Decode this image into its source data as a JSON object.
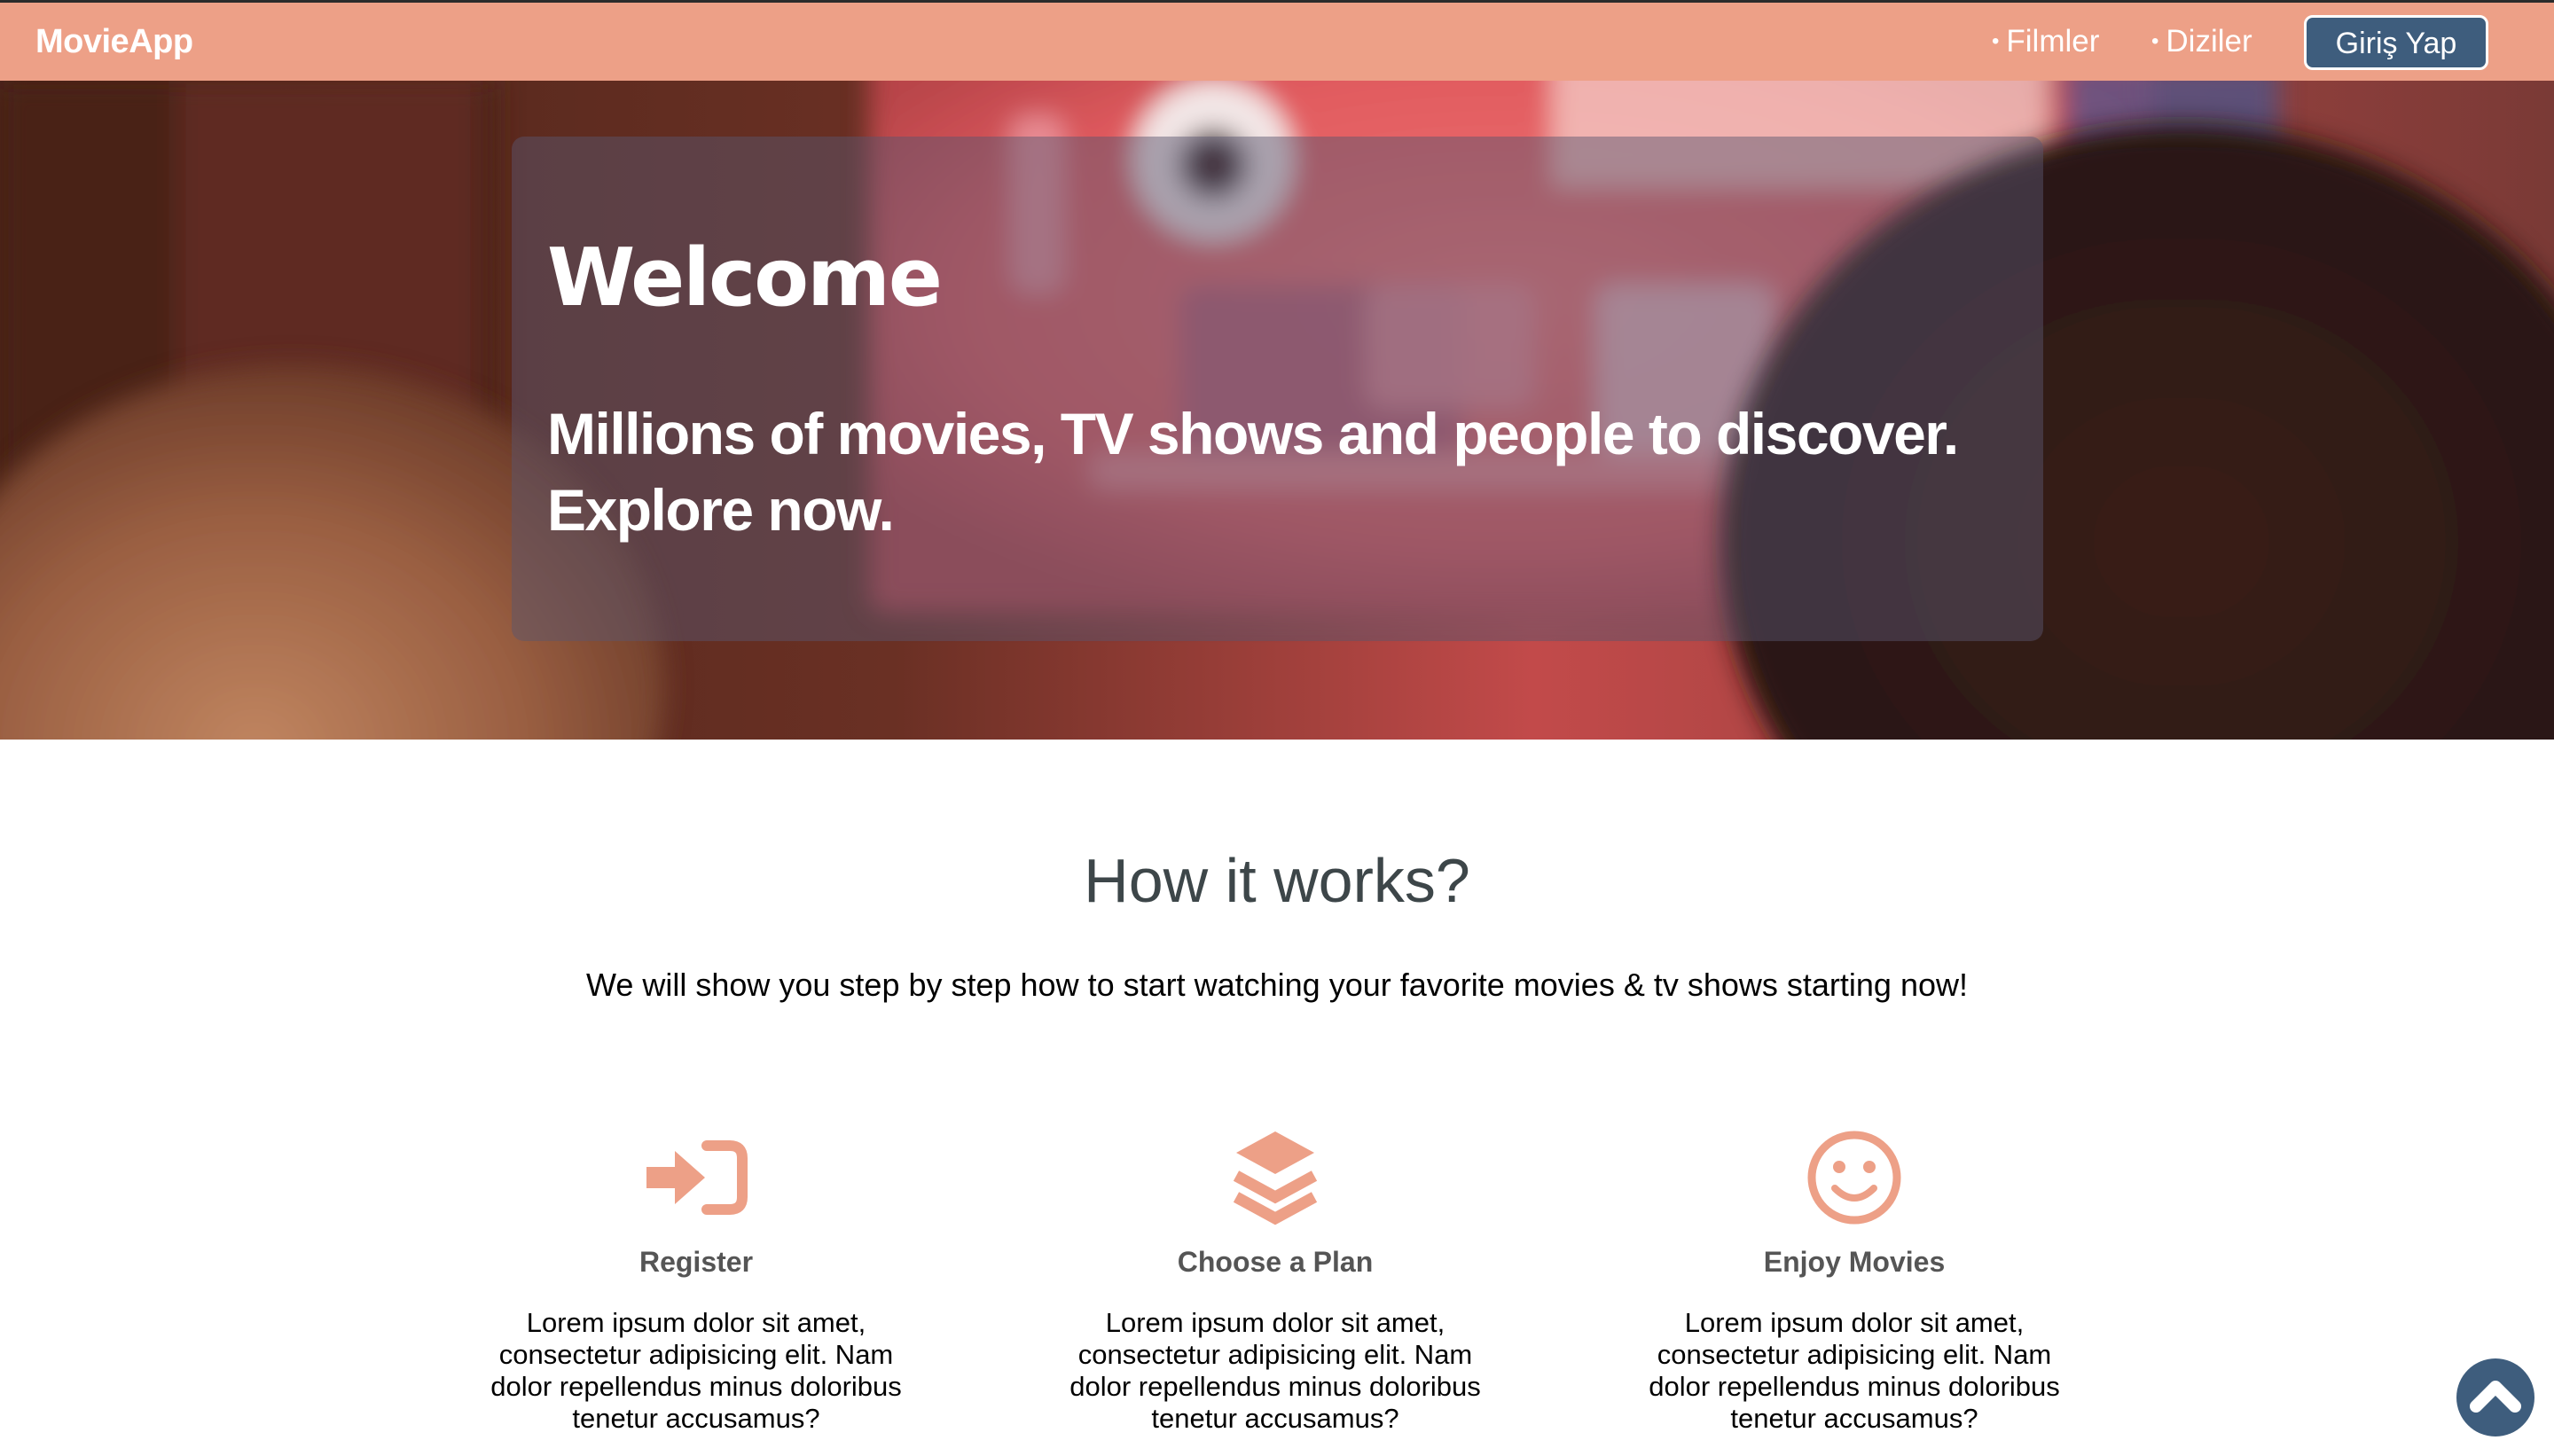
{
  "navbar": {
    "brand": "MovieApp",
    "links": [
      {
        "bullet": "•",
        "label": "Filmler"
      },
      {
        "bullet": "•",
        "label": "Diziler"
      }
    ],
    "login_label": "Giriş Yap",
    "background_color": "#eda087",
    "button_color": "#3e5d7d"
  },
  "hero": {
    "title": "Welcome",
    "subtitle": "Millions of movies, TV shows and people to discover. Explore now."
  },
  "how_it_works": {
    "title": "How it works?",
    "subtitle": "We will show you step by step how to start watching your favorite movies & tv shows starting now!",
    "steps": [
      {
        "icon": "sign-in-icon",
        "title": "Register",
        "text": "Lorem ipsum dolor sit amet, consectetur adipisicing elit. Nam dolor repellendus minus doloribus tenetur accusamus?"
      },
      {
        "icon": "layers-icon",
        "title": "Choose a Plan",
        "text": "Lorem ipsum dolor sit amet, consectetur adipisicing elit. Nam dolor repellendus minus doloribus tenetur accusamus?"
      },
      {
        "icon": "smile-icon",
        "title": "Enjoy Movies",
        "text": "Lorem ipsum dolor sit amet, consectetur adipisicing elit. Nam dolor repellendus minus doloribus tenetur accusamus?"
      }
    ],
    "icon_color": "#eda087"
  },
  "scroll_top": {
    "icon": "chevron-up-icon"
  }
}
